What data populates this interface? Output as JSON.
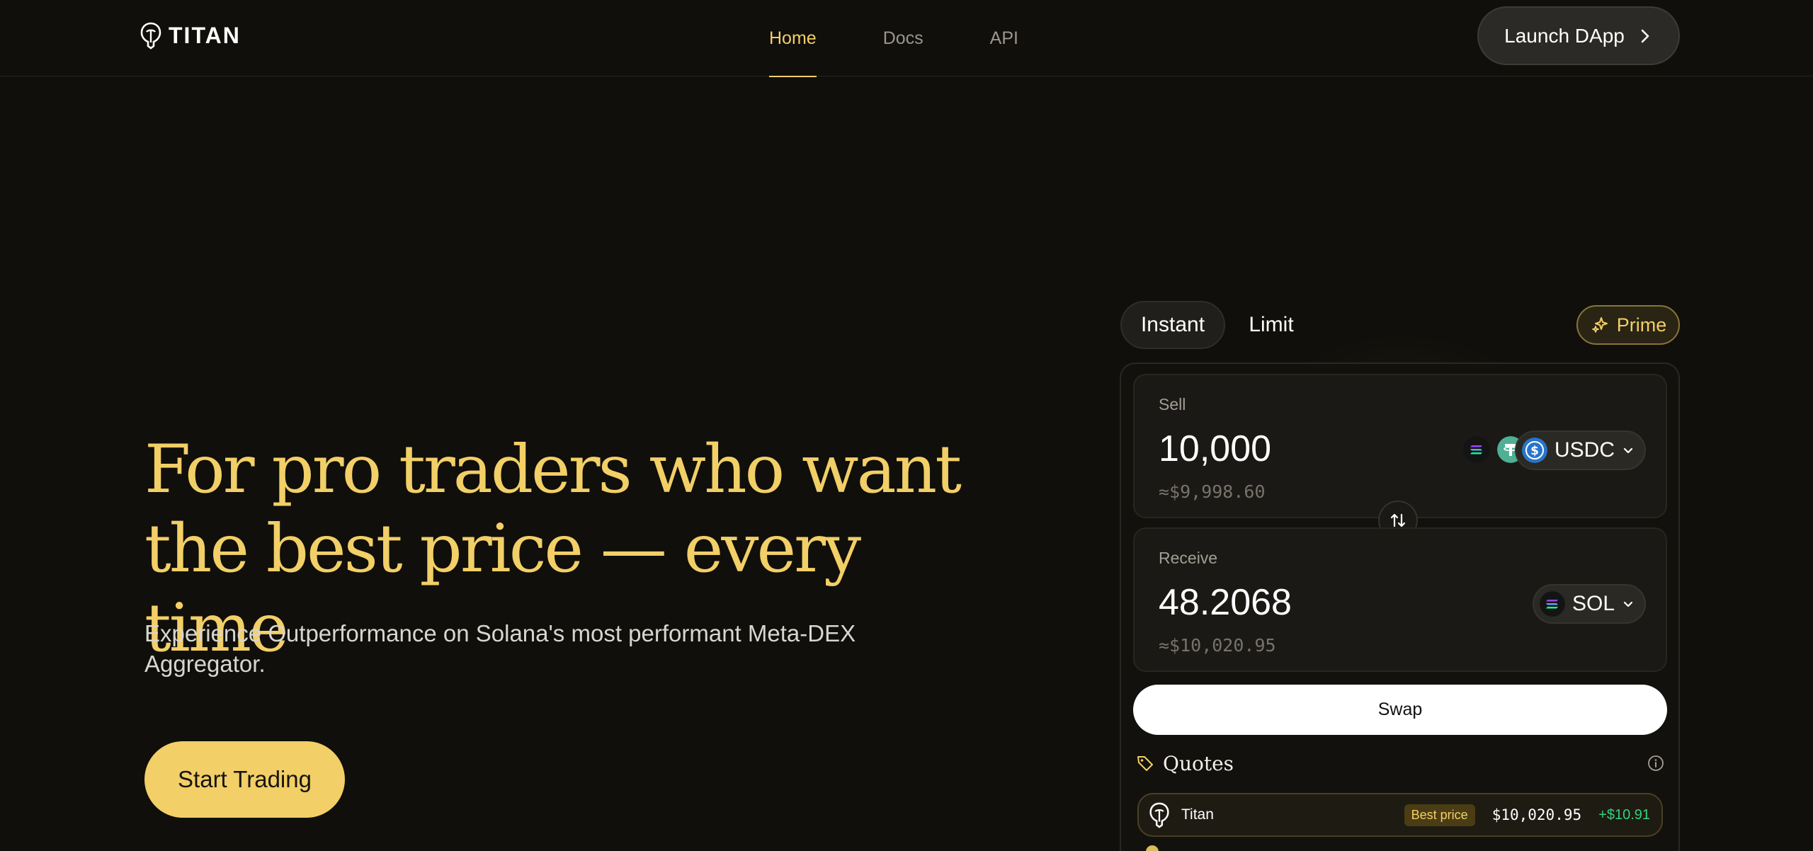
{
  "brand": {
    "name": "TITAN"
  },
  "nav": {
    "links": [
      {
        "label": "Home",
        "active": true
      },
      {
        "label": "Docs",
        "active": false
      },
      {
        "label": "API",
        "active": false
      }
    ],
    "launch_label": "Launch DApp"
  },
  "hero": {
    "title": "For pro traders who want the best price — every time",
    "subtitle": "Experience Outperformance on Solana's most performant Meta-DEX Aggregator.",
    "cta_label": "Start Trading"
  },
  "swap": {
    "tabs": [
      {
        "label": "Instant",
        "active": true
      },
      {
        "label": "Limit",
        "active": false
      }
    ],
    "prime_label": "Prime",
    "sell": {
      "label": "Sell",
      "amount": "10,000",
      "usd": "≈$9,998.60",
      "token": "USDC",
      "quick_tokens": [
        "sol-coin-icon",
        "usdt-coin-icon"
      ]
    },
    "receive": {
      "label": "Receive",
      "amount": "48.2068",
      "usd": "≈$10,020.95",
      "token": "SOL"
    },
    "swap_label": "Swap",
    "quotes": {
      "title": "Quotes",
      "rows": [
        {
          "name": "Titan",
          "badge": "Best price",
          "price": "$10,020.95",
          "diff": "+$10.91"
        }
      ]
    }
  },
  "colors": {
    "background": "#100f0b",
    "accent": "#f2cf67",
    "positive": "#35d07f",
    "usdc": "#2775ca",
    "usdt": "#50af95"
  }
}
